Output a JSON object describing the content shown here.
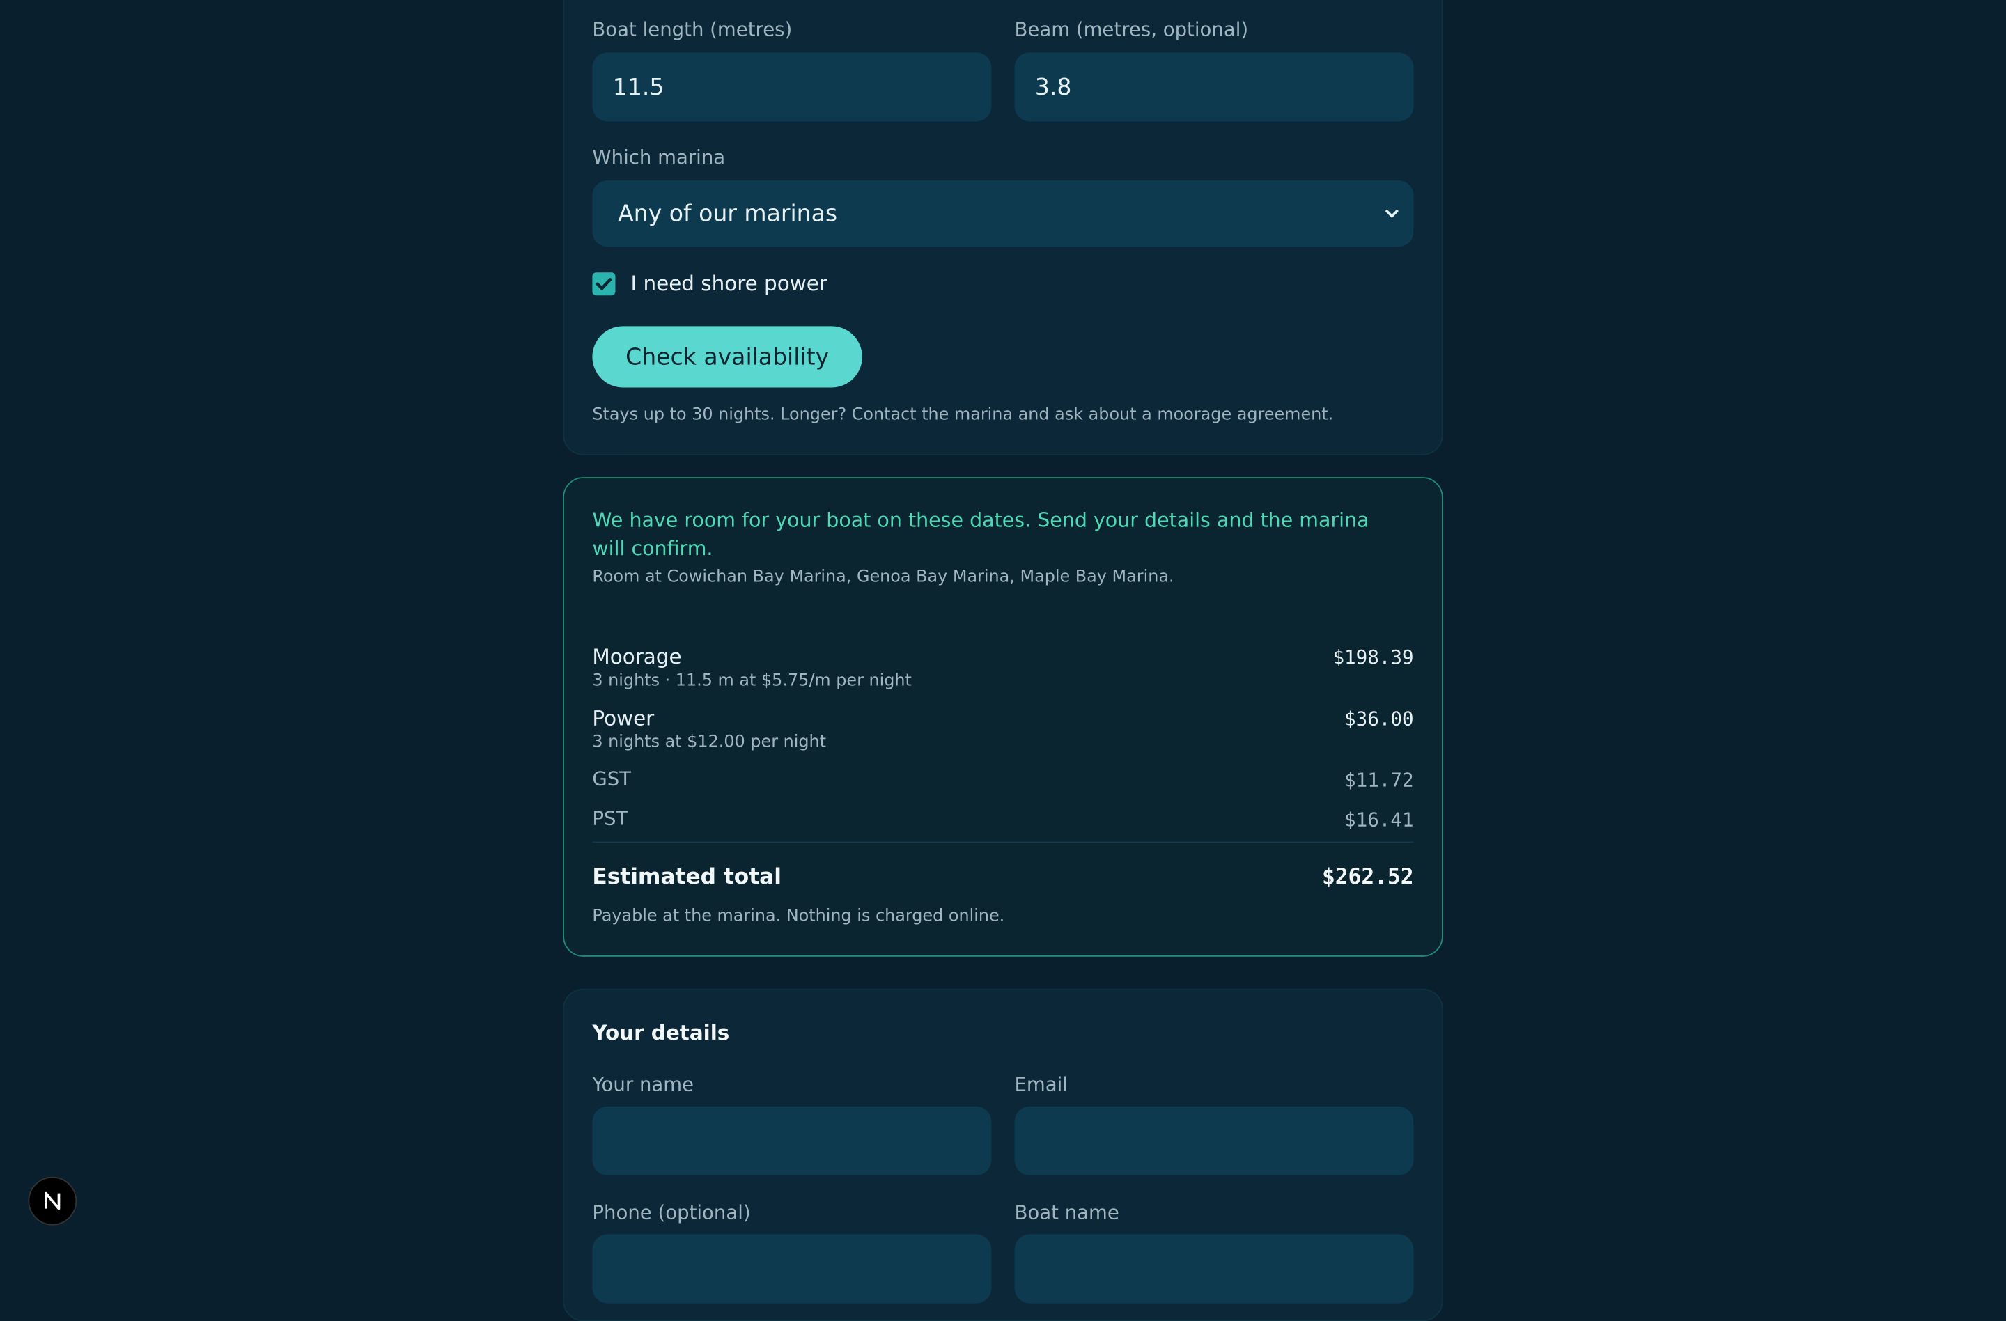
{
  "booking": {
    "boat_length_label": "Boat length (metres)",
    "boat_length_value": "11.5",
    "beam_label": "Beam (metres, optional)",
    "beam_value": "3.8",
    "marina_label": "Which marina",
    "marina_selected": "Any of our marinas",
    "shore_power_label": "I need shore power",
    "shore_power_checked": true,
    "check_button": "Check availability",
    "stay_note": "Stays up to 30 nights. Longer? Contact the marina and ask about a moorage agreement."
  },
  "result": {
    "headline": "We have room for your boat on these dates. Send your details and the marina will confirm.",
    "room_at": "Room at Cowichan Bay Marina, Genoa Bay Marina, Maple Bay Marina.",
    "lines": [
      {
        "label": "Moorage",
        "detail": "3 nights · 11.5 m at $5.75/m per night",
        "amount": "$198.39"
      },
      {
        "label": "Power",
        "detail": "3 nights at $12.00 per night",
        "amount": "$36.00"
      },
      {
        "label": "GST",
        "detail": "",
        "amount": "$11.72"
      },
      {
        "label": "PST",
        "detail": "",
        "amount": "$16.41"
      }
    ],
    "total_label": "Estimated total",
    "total_amount": "$262.52",
    "payment_note": "Payable at the marina. Nothing is charged online."
  },
  "details": {
    "title": "Your details",
    "name_label": "Your name",
    "name_value": "",
    "email_label": "Email",
    "email_value": "",
    "phone_label": "Phone (optional)",
    "boat_name_label": "Boat name"
  },
  "badge": {
    "letter": "N"
  },
  "colors": {
    "accent": "#5ad8cf",
    "success_text": "#4fd8b5",
    "background": "#0a1f2e"
  }
}
